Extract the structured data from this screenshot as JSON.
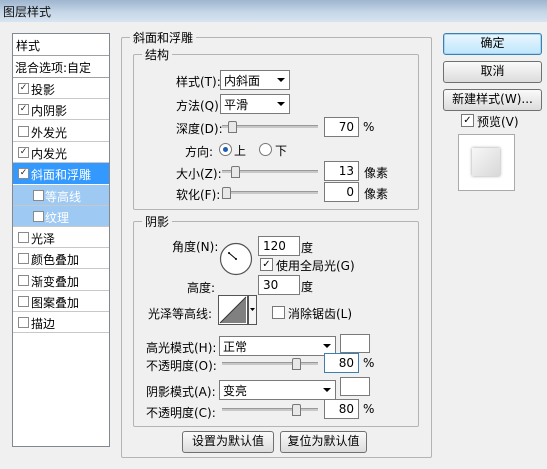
{
  "window": {
    "title": "图层样式"
  },
  "sidebar": {
    "header": "样式",
    "blend_options": "混合选项:自定",
    "items": [
      {
        "label": "投影",
        "checked": true
      },
      {
        "label": "内阴影",
        "checked": true
      },
      {
        "label": "外发光",
        "checked": false
      },
      {
        "label": "内发光",
        "checked": true
      },
      {
        "label": "斜面和浮雕",
        "checked": true,
        "selected": true
      },
      {
        "label": "等高线",
        "checked": false,
        "sub": true
      },
      {
        "label": "纹理",
        "checked": false,
        "sub": true
      },
      {
        "label": "光泽",
        "checked": false
      },
      {
        "label": "颜色叠加",
        "checked": false
      },
      {
        "label": "渐变叠加",
        "checked": false
      },
      {
        "label": "图案叠加",
        "checked": false
      },
      {
        "label": "描边",
        "checked": false
      }
    ],
    "check_glyph": "✓",
    "selection_color": "#3399ff"
  },
  "bevel": {
    "section_title": "斜面和浮雕",
    "structure": {
      "title": "结构",
      "style_label": "样式(T):",
      "style_value": "内斜面",
      "technique_label": "方法(Q):",
      "technique_value": "平滑",
      "depth_label": "深度(D):",
      "depth_value": "70",
      "depth_unit": "%",
      "depth_fraction": 0.07,
      "direction_label": "方向:",
      "direction_up": "上",
      "direction_down": "下",
      "size_label": "大小(Z):",
      "size_value": "13",
      "size_unit": "像素",
      "size_fraction": 0.1,
      "soften_label": "软化(F):",
      "soften_value": "0",
      "soften_unit": "像素",
      "soften_fraction": 0.0
    },
    "shading": {
      "title": "阴影",
      "angle_label": "角度(N):",
      "angle_value": "120",
      "angle_unit": "度",
      "global_light_label": "使用全局光(G)",
      "global_light_checked": true,
      "altitude_label": "高度:",
      "altitude_value": "30",
      "altitude_unit": "度",
      "gloss_contour_label": "光泽等高线:",
      "anti_alias_label": "消除锯齿(L)",
      "anti_alias_checked": false,
      "highlight_mode_label": "高光模式(H):",
      "highlight_mode_value": "正常",
      "highlight_color": "#ffffff",
      "highlight_opacity_label": "不透明度(O):",
      "highlight_opacity_value": "80",
      "highlight_opacity_unit": "%",
      "highlight_opacity_fraction": 0.8,
      "shadow_mode_label": "阴影模式(A):",
      "shadow_mode_value": "变亮",
      "shadow_color": "#ffffff",
      "shadow_opacity_label": "不透明度(C):",
      "shadow_opacity_value": "80",
      "shadow_opacity_unit": "%",
      "shadow_opacity_fraction": 0.8
    },
    "make_default": "设置为默认值",
    "reset_default": "复位为默认值"
  },
  "actions": {
    "ok": "确定",
    "cancel": "取消",
    "new_style": "新建样式(W)...",
    "preview_label": "预览(V)",
    "preview_checked": true
  }
}
